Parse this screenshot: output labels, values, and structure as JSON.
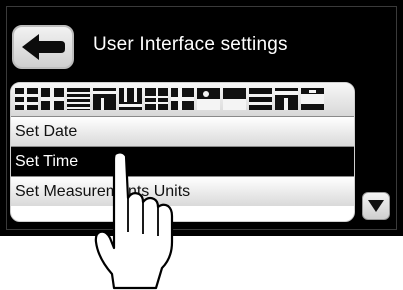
{
  "header": {
    "back_icon": "back-arrow-icon",
    "title": "User Interface settings"
  },
  "language_flags": {
    "count": 12
  },
  "menu": {
    "items": [
      {
        "label": "Set Date",
        "selected": false
      },
      {
        "label": "Set Time",
        "selected": true
      },
      {
        "label": "Set Measurements Units",
        "selected": false
      }
    ]
  },
  "scroll": {
    "icon": "triangle-down-icon"
  },
  "overlay": {
    "icon": "pointing-hand-icon"
  },
  "colors": {
    "screen_bg": "#000000",
    "selected_bg": "#000000",
    "selected_text": "#ffffff"
  }
}
